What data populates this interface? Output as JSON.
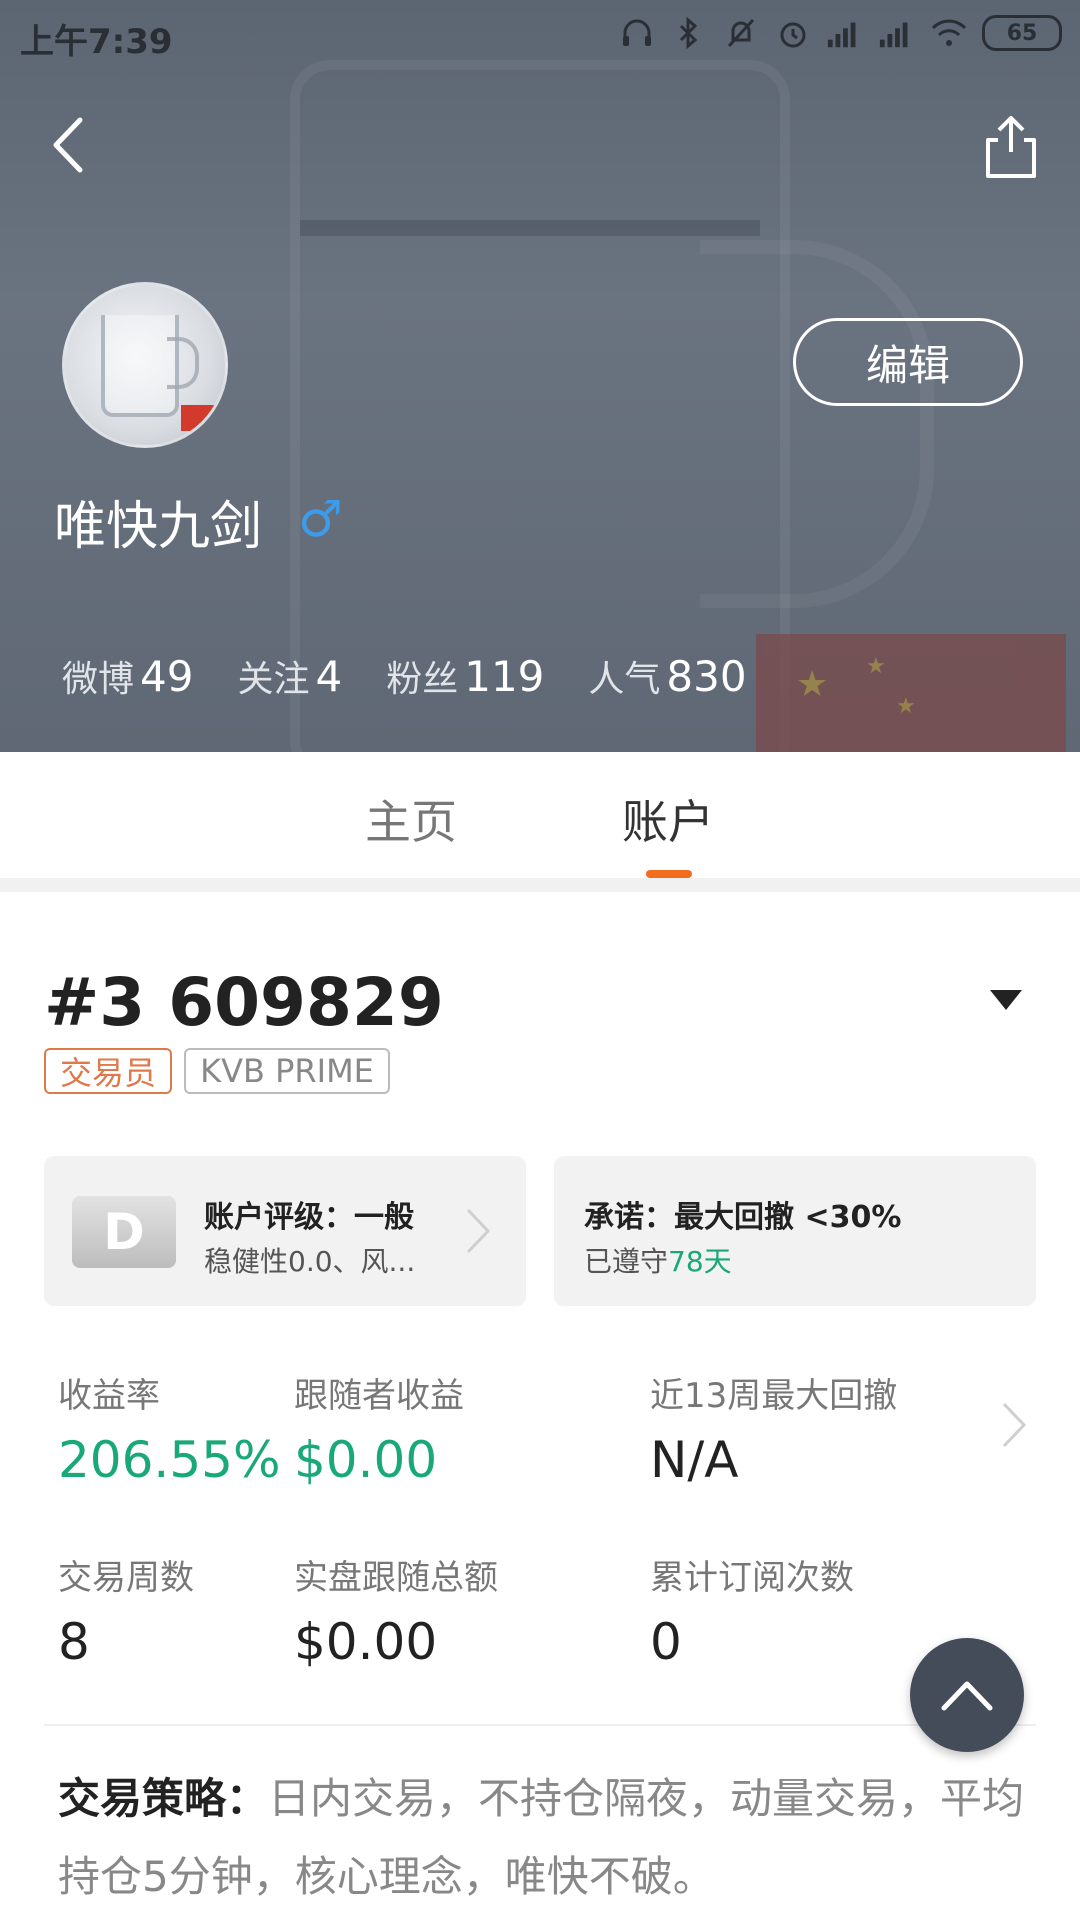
{
  "status_bar": {
    "time": "上午7:39",
    "battery": "65"
  },
  "header": {
    "edit_label": "编辑",
    "username": "唯快九剑",
    "gender_symbol": "♂",
    "gender_color": "#3d9be9",
    "stats": [
      {
        "label": "微博",
        "value": "49"
      },
      {
        "label": "关注",
        "value": "4"
      },
      {
        "label": "粉丝",
        "value": "119"
      },
      {
        "label": "人气",
        "value": "830"
      }
    ]
  },
  "tabs": [
    {
      "label": "主页",
      "active": false
    },
    {
      "label": "账户",
      "active": true
    }
  ],
  "account": {
    "title": "#3 609829",
    "tags": [
      "交易员",
      "KVB PRIME"
    ],
    "rating_card": {
      "grade": "D",
      "title": "账户评级：一般",
      "subtitle": "稳健性0.0、风..."
    },
    "promise_card": {
      "title": "承诺：最大回撤 <30%",
      "sub_prefix": "已遵守",
      "sub_days": "78天"
    },
    "metrics": [
      {
        "label": "收益率",
        "value": "206.55%"
      },
      {
        "label": "跟随者收益",
        "value": "$0.00"
      },
      {
        "label": "近13周最大回撤",
        "value": "N/A"
      },
      {
        "label": "交易周数",
        "value": "8"
      },
      {
        "label": "实盘跟随总额",
        "value": "$0.00"
      },
      {
        "label": "累计订阅次数",
        "value": "0"
      }
    ],
    "strategy_label": "交易策略：",
    "strategy_text": "日内交易，不持仓隔夜，动量交易，平均持仓5分钟，核心理念，唯快不破。"
  },
  "colors": {
    "accent_orange": "#f36b1f",
    "positive_green": "#19a877",
    "fab_bg": "#454c59"
  },
  "icons": [
    "back-arrow-icon",
    "share-icon",
    "chevron-right-icon",
    "dropdown-triangle-icon",
    "scroll-top-icon"
  ]
}
